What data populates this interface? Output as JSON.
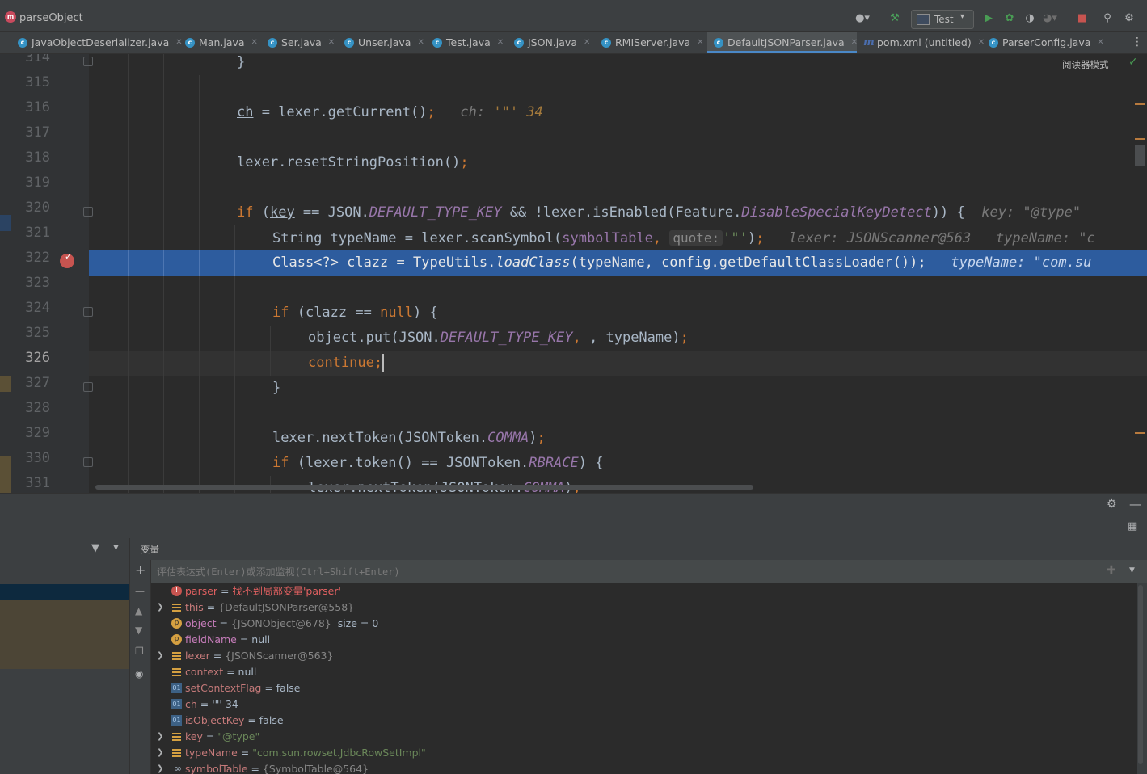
{
  "nav": {
    "title": "parseObject",
    "run_config": "Test"
  },
  "tabs": [
    {
      "label": "JavaObjectDeserializer.java"
    },
    {
      "label": "Man.java"
    },
    {
      "label": "Ser.java"
    },
    {
      "label": "Unser.java"
    },
    {
      "label": "Test.java"
    },
    {
      "label": "JSON.java"
    },
    {
      "label": "RMIServer.java"
    },
    {
      "label": "DefaultJSONParser.java",
      "active": true
    },
    {
      "label": "pom.xml (untitled)"
    },
    {
      "label": "ParserConfig.java"
    }
  ],
  "editor": {
    "reader_mode": "阅读器模式",
    "line_numbers": [
      "314",
      "315",
      "316",
      "317",
      "318",
      "319",
      "320",
      "321",
      "322",
      "323",
      "324",
      "325",
      "326",
      "327",
      "328",
      "329",
      "330",
      "331"
    ],
    "current_line": "326",
    "breakpoint_line": "322",
    "code": {
      "l314": "}",
      "l316_var": "ch",
      "l316_call": " = lexer.getCurrent()",
      "l316_semi": ";",
      "l316_hint_name": "ch: ",
      "l316_hint_val": "'\"' 34",
      "l318": "lexer.resetStringPosition()",
      "l318_semi": ";",
      "l320_if": "if",
      "l320_a": " (",
      "l320_key": "key",
      "l320_b": " == JSON.",
      "l320_const": "DEFAULT_TYPE_KEY",
      "l320_c": " && !lexer.isEnabled(Feature.",
      "l320_feat": "DisableSpecialKeyDetect",
      "l320_d": ")) {",
      "l320_hint": "key: \"@type\"",
      "l321_a": "String typeName = lexer.scanSymbol(",
      "l321_field": "symbolTable",
      "l321_b": ", ",
      "l321_param": "quote:",
      "l321_str": "'\"'",
      "l321_c": ")",
      "l321_semi": ";",
      "l321_hint1": "lexer: JSONScanner@563",
      "l321_hint2": "typeName: \"c",
      "l322_a": "Class<?> clazz = TypeUtils.",
      "l322_method": "loadClass",
      "l322_b": "(typeName, ",
      "l322_field": "config",
      "l322_c": ".getDefaultClassLoader())",
      "l322_semi": ";",
      "l322_hint": "typeName: \"com.su",
      "l324_if": "if",
      "l324_a": " (clazz == ",
      "l324_null": "null",
      "l324_b": ") {",
      "l325_a": "object.put(JSON.",
      "l325_const": "DEFAULT_TYPE_KEY",
      "l325_b": ", typeName)",
      "l325_semi": ";",
      "l326": "continue;",
      "l327": "}",
      "l329_a": "lexer.nextToken(JSONToken.",
      "l329_const": "COMMA",
      "l329_b": ")",
      "l329_semi": ";",
      "l330_if": "if",
      "l330_a": " (lexer.token() == JSONToken.",
      "l330_const": "RBRACE",
      "l330_b": ") {",
      "l331_a": "lexer.nextToken(JSONToken.",
      "l331_const": "COMMA",
      "l331_b": ")",
      "l331_semi": ";"
    }
  },
  "debug": {
    "variables_title": "变量",
    "eval_placeholder": "评估表达式(Enter)或添加监视(Ctrl+Shift+Enter)",
    "variables": [
      {
        "icon": "error",
        "name": "parser",
        "eq": " = ",
        "value": "找不到局部变量'parser'",
        "kind": "error",
        "expandable": false
      },
      {
        "icon": "field",
        "name": "this",
        "eq": " = ",
        "value": "{DefaultJSONParser@558}",
        "kind": "dim",
        "expandable": true
      },
      {
        "icon": "param",
        "name": "object",
        "eq": " = ",
        "value": "{JSONObject@678}",
        "kind": "dim",
        "extra": "  size = 0",
        "expandable": false
      },
      {
        "icon": "param",
        "name": "fieldName",
        "eq": " = ",
        "value": "null",
        "kind": "plain",
        "expandable": false
      },
      {
        "icon": "field",
        "name": "lexer",
        "eq": " = ",
        "value": "{JSONScanner@563}",
        "kind": "dim",
        "expandable": true
      },
      {
        "icon": "field",
        "name": "context",
        "eq": " = ",
        "value": "null",
        "kind": "plain",
        "expandable": false
      },
      {
        "icon": "bool",
        "name": "setContextFlag",
        "eq": " = ",
        "value": "false",
        "kind": "plain",
        "expandable": false
      },
      {
        "icon": "bool",
        "name": "ch",
        "eq": " = ",
        "value": "'\"' 34",
        "kind": "plain",
        "expandable": false
      },
      {
        "icon": "bool",
        "name": "isObjectKey",
        "eq": " = ",
        "value": "false",
        "kind": "plain",
        "expandable": false
      },
      {
        "icon": "field",
        "name": "key",
        "eq": " = ",
        "value": "\"@type\"",
        "kind": "str",
        "expandable": true
      },
      {
        "icon": "field",
        "name": "typeName",
        "eq": " = ",
        "value": "\"com.sun.rowset.JdbcRowSetImpl\"",
        "kind": "str",
        "expandable": true
      },
      {
        "icon": "oo",
        "name": "symbolTable",
        "eq": " = ",
        "value": "{SymbolTable@564}",
        "kind": "dim",
        "expandable": true
      }
    ]
  }
}
